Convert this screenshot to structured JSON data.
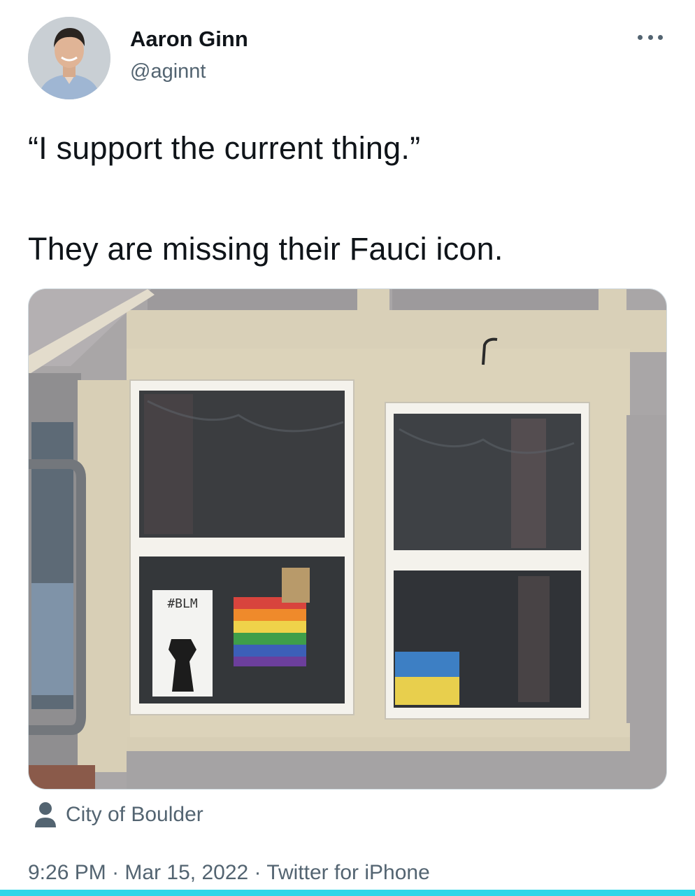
{
  "author": {
    "name": "Aaron Ginn",
    "handle": "@aginnt"
  },
  "tweet": {
    "line1": "“I support the current thing.”",
    "line2": "They are missing their Fauci icon."
  },
  "media": {
    "sign_text": "#BLM"
  },
  "location": {
    "icon": "person-icon",
    "text": "City of Boulder"
  },
  "meta": {
    "time": "9:26 PM",
    "sep1": " · ",
    "date": "Mar 15, 2022",
    "sep2": " · ",
    "source": "Twitter for iPhone"
  },
  "colors": {
    "text": "#0f1419",
    "secondary": "#536471",
    "accent_bar": "#2fd6e8"
  }
}
